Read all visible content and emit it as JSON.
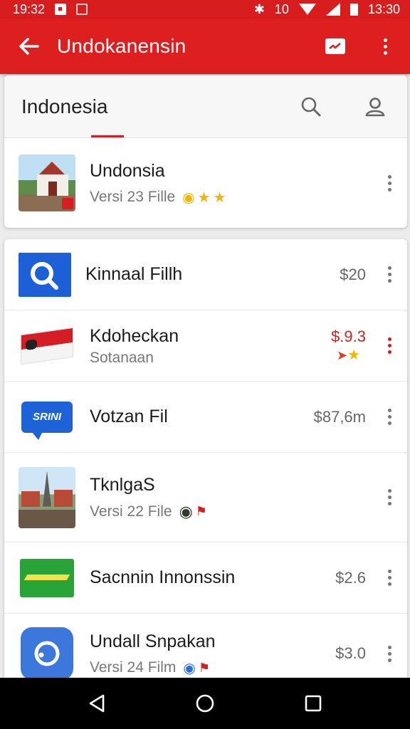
{
  "status_bar": {
    "time_left": "19:32",
    "signal_text": "10",
    "time_right": "13:30"
  },
  "app_bar": {
    "title": "Undokanensin",
    "icons": [
      "back-arrow-icon",
      "chart-icon",
      "more-vert-icon"
    ]
  },
  "header": {
    "search_title": "Indonesia"
  },
  "featured": {
    "title": "Undonsia",
    "subtitle": "Versi  23 Fille"
  },
  "items": [
    {
      "title": "Kinnaal Fillh",
      "price": "$20",
      "subtitle": "",
      "thumb": "blue-search"
    },
    {
      "title": "Kdoheckan",
      "subtitle": "Sotanaan",
      "price": "$.9.3",
      "price_color": "#d71d1d",
      "thumb": "flag"
    },
    {
      "title": "Votzan Fil",
      "price": "$87,6m",
      "subtitle": "",
      "thumb": "chat",
      "thumb_text": "SRINI"
    },
    {
      "title": "TknlgaS",
      "subtitle": "Versi  22 File",
      "price": "",
      "thumb": "temple"
    },
    {
      "title": "Sacnnin Innonssin",
      "price": "$2.6",
      "subtitle": "",
      "thumb": "green"
    },
    {
      "title": "Undall Snpakan",
      "subtitle": "Versi  24 Film",
      "price": "$3.0",
      "thumb": "app"
    }
  ],
  "colors": {
    "primary": "#dd1f1f",
    "accent_red": "#d71d1d",
    "star": "#f2b600"
  }
}
